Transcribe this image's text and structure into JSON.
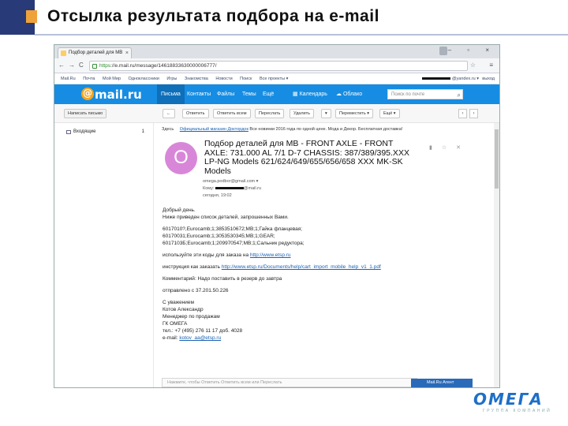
{
  "slide": {
    "title": "Отсылка результата подбора на e-mail",
    "logo_text": "ОМЕГА",
    "logo_sub": "ГРУППА  КОМПАНИЙ",
    "accent_dark": "#283a78",
    "accent_orange": "#f0a23a"
  },
  "browser": {
    "tab_title": "Подбор деталей для МВ",
    "tab_close": "×",
    "window_controls": "– ▫ ×",
    "back": "←",
    "forward": "→",
    "reload": "C",
    "url_scheme": "https",
    "url_rest": "://e.mail.ru/message/14618833630000006777/",
    "bookmark": "☆",
    "menu": "≡"
  },
  "portal": {
    "links": [
      "Mail.Ru",
      "Почта",
      "Мой Мир",
      "Одноклассники",
      "Игры",
      "Знакомства",
      "Новости",
      "Поиск",
      "Все проекты ▾"
    ],
    "user_suffix": "@yandex.ru ▾",
    "logout": "выход"
  },
  "mail_header": {
    "logo_at": "@",
    "logo": "mail.ru",
    "nav": [
      "Письма",
      "Контакты",
      "Файлы",
      "Темы",
      "Ещё"
    ],
    "nav_active": "Письма",
    "calendar": "Календарь",
    "cloud": "Облако",
    "search_placeholder": "Поиск по почте",
    "accent": "#168de2"
  },
  "toolbar": {
    "write": "Написать письмо",
    "back": "←",
    "reply": "Ответить",
    "reply_all": "Ответить всем",
    "forward": "Переслать",
    "delete": "Удалить",
    "spam": "▾",
    "move": "Переместить ▾",
    "more": "Ещё ▾",
    "prev": "‹",
    "next": "›"
  },
  "sidebar": {
    "folders": [
      {
        "label": "Входящие",
        "count": "1"
      }
    ]
  },
  "message": {
    "crumb": "Здесь",
    "crumb_ad_label": "Официальный магазин Доктордок",
    "crumb_ad_text": "Все новинки 2016 года по одной цене. Мода и Декор. Бесплатная доставка!",
    "avatar_letter": "O",
    "subject": "Подбор деталей для МВ - FRONT AXLE - FRONT AXLE: 731.000 AL 7/1 D-7 CHASSIS: 387/389/395.XXX LP-NG Models 621/624/649/655/656/658 XXX MK-SK Models",
    "from": "omega.podbor@gmail.com",
    "from_caret": "▾",
    "to_label": "Кому:",
    "to_suffix": "@mail.ru",
    "date": "сегодня, 19:02",
    "greeting": "Добрый день.",
    "intro": "Ниже приведен список деталей, запрошенных Вами.",
    "items": [
      "6017010?,Eurocamb;1;3853510672;MB;1;Гайка фланцевая;",
      "60170031;Eurocamb;1;3053530345;MB;1;GEAR;",
      "6017103Б;Eurocamb;1;209970547;MB;1;Сальник редуктора;"
    ],
    "codes_line_text": "используйте эти коды для заказа на",
    "codes_link": "http://www.etsp.ru",
    "instr_text": "инструкция как заказать",
    "instr_link": "http://www.etsp.ru/Documents/help/cart_import_mobile_help_v1_1.pdf",
    "comment": "Комментарий: Надо поставить в резерв до завтра",
    "sent_from": "отправлено с 37.201.50.226",
    "sig": [
      "С уважением",
      "Котов Александр",
      "Менеджер по продажам",
      "ГК ОМЕГА",
      "тел.: +7 (495) 276 11 17 доб. 4028"
    ],
    "email_label": "e-mail:",
    "email_link": "kotov_aa@etsp.ru",
    "reply_placeholder": "Нажмите, чтобы Ответить Ответить всем или Переслать",
    "agent": "Mail.Ru Агент"
  }
}
